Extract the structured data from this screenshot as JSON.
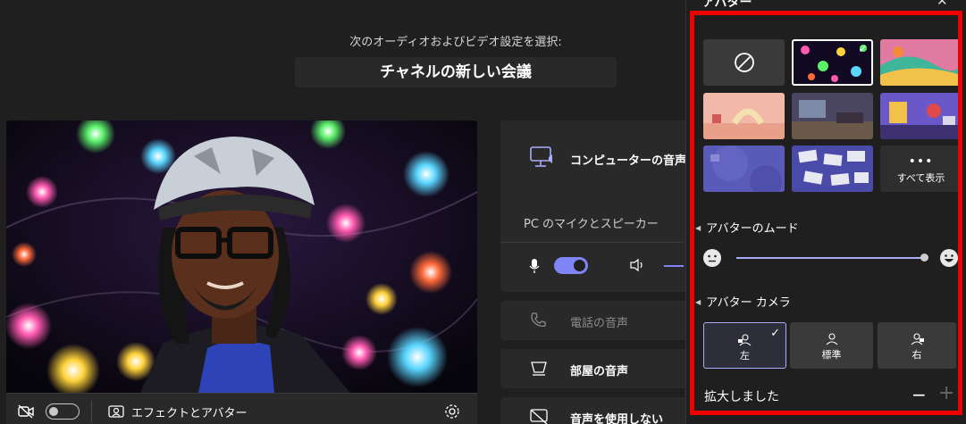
{
  "prompt": "次のオーディオおよびビデオ設定を選択:",
  "meeting_title": "チャネルの新しい会議",
  "preview_toolbar": {
    "effects_label": "エフェクトとアバター"
  },
  "audio": {
    "computer_audio": "コンピューターの音声",
    "pc_mic_speaker": "PC のマイクとスピーカー",
    "phone_audio": "電話の音声",
    "room_audio": "部屋の音声",
    "no_audio": "音声を使用しない"
  },
  "panel": {
    "title": "アバター",
    "show_all": "すべて表示",
    "mood_section": "アバターのムード",
    "camera_section": "アバター カメラ",
    "camera_options": [
      "左",
      "標準",
      "右"
    ],
    "zoom_label": "拡大しました",
    "zoom_minus": "−",
    "zoom_plus": "+"
  },
  "colors": {
    "accent": "#7f85f5",
    "highlight_box": "#ee0000",
    "panel_bg": "#1f1f1f",
    "card_bg": "#292929"
  }
}
